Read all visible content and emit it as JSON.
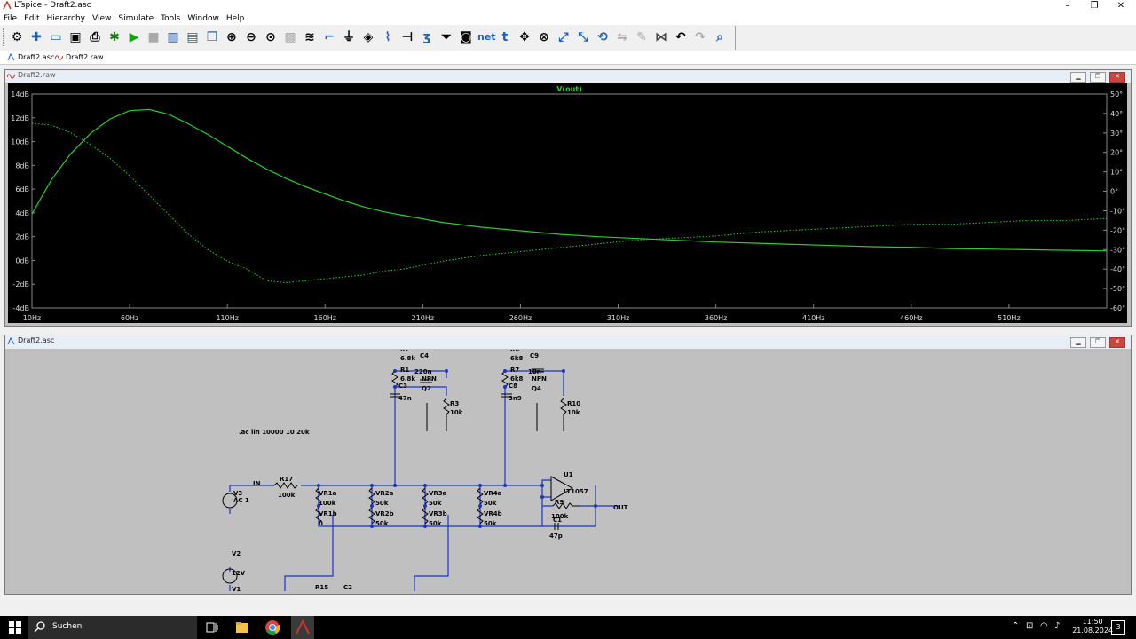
{
  "window": {
    "title": "LTspice - Draft2.asc"
  },
  "menu": [
    "File",
    "Edit",
    "Hierarchy",
    "View",
    "Simulate",
    "Tools",
    "Window",
    "Help"
  ],
  "tabs": [
    {
      "label": "Draft2.asc"
    },
    {
      "label": "Draft2.raw"
    }
  ],
  "plot_window": {
    "title": "Draft2.raw"
  },
  "schematic_window": {
    "title": "Draft2.asc"
  },
  "chart_data": {
    "type": "line",
    "title": "V(out)",
    "x": [
      10,
      20,
      30,
      40,
      50,
      60,
      70,
      80,
      90,
      100,
      110,
      120,
      130,
      140,
      150,
      160,
      170,
      180,
      190,
      200,
      220,
      240,
      260,
      280,
      300,
      320,
      340,
      360,
      380,
      400,
      420,
      440,
      460,
      480,
      500,
      520,
      540,
      560
    ],
    "series": [
      {
        "name": "V(out)",
        "axis": "left",
        "unit": "dB",
        "values": [
          3.9,
          6.8,
          9.0,
          10.7,
          11.9,
          12.6,
          12.7,
          12.3,
          11.5,
          10.6,
          9.6,
          8.6,
          7.7,
          6.9,
          6.2,
          5.6,
          5.0,
          4.5,
          4.1,
          3.8,
          3.2,
          2.8,
          2.5,
          2.2,
          2.0,
          1.85,
          1.7,
          1.55,
          1.45,
          1.35,
          1.25,
          1.15,
          1.1,
          1.0,
          0.95,
          0.9,
          0.85,
          0.8
        ]
      },
      {
        "name": "V(out) phase",
        "axis": "right",
        "unit": "deg",
        "dashed": true,
        "values": [
          35,
          34,
          30,
          24,
          17,
          8,
          -2,
          -12,
          -22,
          -30,
          -36,
          -40,
          -46,
          -47,
          -46,
          -45,
          -44,
          -43,
          -41,
          -40,
          -36,
          -33,
          -31,
          -29,
          -27,
          -25,
          -24,
          -23,
          -21,
          -20,
          -19,
          -18,
          -17,
          -17,
          -16,
          -15,
          -15,
          -14
        ]
      }
    ],
    "x_ticks": [
      "10Hz",
      "60Hz",
      "110Hz",
      "160Hz",
      "210Hz",
      "260Hz",
      "310Hz",
      "360Hz",
      "410Hz",
      "460Hz",
      "510Hz"
    ],
    "y_left_ticks": [
      "14dB",
      "12dB",
      "10dB",
      "8dB",
      "6dB",
      "4dB",
      "2dB",
      "0dB",
      "-2dB",
      "-4dB"
    ],
    "y_right_ticks": [
      "50°",
      "40°",
      "30°",
      "20°",
      "10°",
      "0°",
      "-10°",
      "-20°",
      "-30°",
      "-40°",
      "-50°",
      "-60°"
    ],
    "xlim": [
      10,
      560
    ],
    "ylim_left": [
      -4,
      14
    ],
    "ylim_right": [
      -60,
      50
    ],
    "grid": false,
    "trace_color": "#2ecc2e"
  },
  "schematic": {
    "directive": ".ac lin 10000 10 20k",
    "labels": {
      "r2": "R2",
      "r2v": "6.8k",
      "c4": "C4",
      "c4v": "220n",
      "r1": "R1",
      "r1v": "6.8k",
      "npn1": "NPN",
      "c3": "C3",
      "q2": "Q2",
      "c3v": "47n",
      "r3": "R3",
      "r3v": "10k",
      "r6": "R6",
      "r6v": "6k8",
      "c9": "C9",
      "c9v": "10n",
      "r7": "R7",
      "r7v": "6k8",
      "npn2": "NPN",
      "c8": "C8",
      "q4": "Q4",
      "c8v": "3n9",
      "r10": "R10",
      "r10v": "10k",
      "in": "IN",
      "r17": "R17",
      "r17v": "100k",
      "v3": "V3",
      "v3v": "AC 1",
      "vr1a": "VR1a",
      "vr1av": "100k",
      "vr1b": "VR1b",
      "vr1bv": "0",
      "vr2a": "VR2a",
      "vr2av": "50k",
      "vr2b": "VR2b",
      "vr2bv": "50k",
      "vr3a": "VR3a",
      "vr3av": "50k",
      "vr3b": "VR3b",
      "vr3bv": "50k",
      "vr4a": "VR4a",
      "vr4av": "50k",
      "vr4b": "VR4b",
      "vr4bv": "50k",
      "u1": "U1",
      "lt1057": "LT1057",
      "r9": "R9",
      "r9v": "100k",
      "c1": "C1",
      "c1v": "47p",
      "out": "OUT",
      "v2": "V2",
      "v2v": "12V",
      "v1": "V1",
      "r15": "R15",
      "c2": "C2"
    }
  },
  "taskbar": {
    "search_placeholder": "Suchen",
    "time": "11:50",
    "date": "21.08.2024",
    "notifications": "3"
  }
}
